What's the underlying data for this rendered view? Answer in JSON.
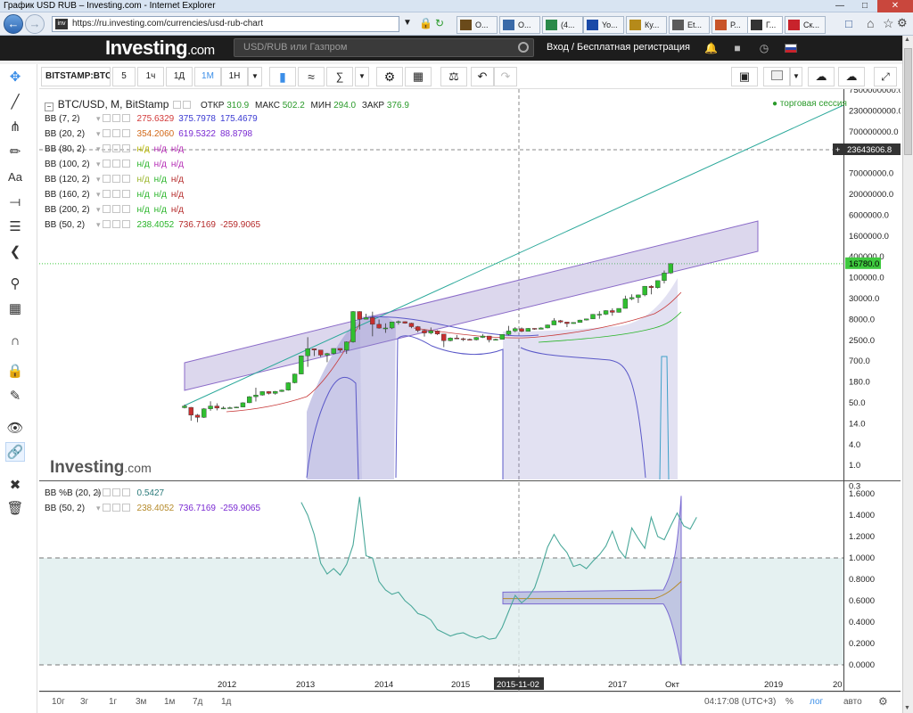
{
  "window": {
    "title": "График USD RUB – Investing.com - Internet Explorer"
  },
  "browser": {
    "url": "https://ru.investing.com/currencies/usd-rub-chart",
    "tabs": [
      {
        "label": "О...",
        "icon": "chart-favicon-icon"
      },
      {
        "label": "О...",
        "icon": "chart-favicon-icon"
      },
      {
        "label": "(4...",
        "icon": "dollar-favicon-icon"
      },
      {
        "label": "Yo...",
        "icon": "yo-favicon-icon"
      },
      {
        "label": "Ку...",
        "icon": "coin-favicon-icon"
      },
      {
        "label": "Et...",
        "icon": "eth-favicon-icon"
      },
      {
        "label": "Р...",
        "icon": "arrows-favicon-icon"
      },
      {
        "label": "Г...",
        "icon": "investing-favicon-icon"
      },
      {
        "label": "Ск...",
        "icon": "mail-favicon-icon"
      }
    ],
    "active_tab": 7
  },
  "site": {
    "logo_main": "Investing",
    "logo_suffix": ".com",
    "search_placeholder": "USD/RUB или Газпром",
    "login": "Вход / Бесплатная регистрация"
  },
  "toolbar": {
    "symbol": "BITSTAMP:BTC/",
    "intervals": [
      "5",
      "1ч",
      "1Д",
      "1М",
      "1Н"
    ],
    "selected_interval": "1М"
  },
  "legend": {
    "title": "BTC/USD, M, BitStamp",
    "open_label": "ОТКР",
    "open": "310.9",
    "high_label": "МАКС",
    "high": "502.2",
    "low_label": "МИН",
    "low": "294.0",
    "close_label": "ЗАКР",
    "close": "376.9",
    "session": "торговая сессия",
    "studies": [
      {
        "name": "BB (7, 2)",
        "v1": "275.6329",
        "v2": "375.7978",
        "v3": "175.4679",
        "c1": "#d23a3a",
        "c2": "#3a3ad2",
        "c3": "#3a3ad2"
      },
      {
        "name": "BB (20, 2)",
        "v1": "354.2060",
        "v2": "619.5322",
        "v3": "88.8798",
        "c1": "#d26a1a",
        "c2": "#7a2ad2",
        "c3": "#7a2ad2"
      },
      {
        "name": "BB (80, 2)",
        "v1": "н/д",
        "v2": "н/д",
        "v3": "н/д",
        "c1": "#b5b500",
        "c2": "#b52ab5",
        "c3": "#b52ab5"
      },
      {
        "name": "BB (100, 2)",
        "v1": "н/д",
        "v2": "н/д",
        "v3": "н/д",
        "c1": "#2ab52a",
        "c2": "#b52ab5",
        "c3": "#b52ab5"
      },
      {
        "name": "BB (120, 2)",
        "v1": "н/д",
        "v2": "н/д",
        "v3": "н/д",
        "c1": "#9ab52a",
        "c2": "#2ab52a",
        "c3": "#b52a2a"
      },
      {
        "name": "BB (160, 2)",
        "v1": "н/д",
        "v2": "н/д",
        "v3": "н/д",
        "c1": "#2ab52a",
        "c2": "#2ab52a",
        "c3": "#b52a2a"
      },
      {
        "name": "BB (200, 2)",
        "v1": "н/д",
        "v2": "н/д",
        "v3": "н/д",
        "c1": "#2ab52a",
        "c2": "#2ab52a",
        "c3": "#b52a2a"
      },
      {
        "name": "BB (50, 2)",
        "v1": "238.4052",
        "v2": "736.7169",
        "v3": "-259.9065",
        "c1": "#2ab52a",
        "c2": "#b52a2a",
        "c3": "#b52a2a"
      }
    ],
    "sub_studies": [
      {
        "name": "BB %B (20, 2)",
        "v1": "0.5427",
        "c1": "#2a7a7a"
      },
      {
        "name": "BB (50, 2)",
        "v1": "238.4052",
        "v2": "736.7169",
        "v3": "-259.9065",
        "c1": "#b58a2a",
        "c2": "#7a2ad2",
        "c3": "#7a2ad2"
      }
    ]
  },
  "watermark": {
    "main": "Investing",
    "suffix": ".com"
  },
  "price_axis": {
    "labels": [
      "7500000000.0",
      "2300000000.0",
      "700000000.0",
      "200000000.0",
      "70000000.0",
      "20000000.0",
      "6000000.0",
      "1600000.0",
      "400000.0",
      "100000.0",
      "30000.0",
      "8000.0",
      "2500.0",
      "700.0",
      "180.0",
      "50.0",
      "14.0",
      "4.0",
      "1.0",
      "0.3"
    ],
    "crosshair_value": "23643606.8",
    "last_value": "16780.0"
  },
  "osc_axis": {
    "labels": [
      "1.6000",
      "1.4000",
      "1.2000",
      "1.0000",
      "0.8000",
      "0.6000",
      "0.4000",
      "0.2000",
      "0.0000"
    ]
  },
  "time_axis": {
    "labels": [
      "2012",
      "2013",
      "2014",
      "2015",
      "2017",
      "Окт",
      "2019",
      "20"
    ],
    "crosshair_date": "2015-11-02"
  },
  "bottom": {
    "ranges": [
      "10г",
      "3г",
      "1г",
      "3м",
      "1м",
      "7д",
      "1д"
    ],
    "clock": "04:17:08 (UTC+3)",
    "percent": "%",
    "log": "лог",
    "auto": "авто"
  },
  "chart_data": {
    "type": "candlestick",
    "title": "BTC/USD, M, BitStamp",
    "scale": "log",
    "x_range": [
      "2011-09",
      "2017-12"
    ],
    "last_close": 16780,
    "candles": [
      {
        "t": "2011-09",
        "o": 5,
        "c": 5.5,
        "h": 6,
        "l": 4.8
      },
      {
        "t": "2011-10",
        "o": 5.1,
        "c": 3.3,
        "h": 5.2,
        "l": 2.4
      },
      {
        "t": "2011-11",
        "o": 3.3,
        "c": 2.9,
        "h": 3.5,
        "l": 2.2
      },
      {
        "t": "2011-12",
        "o": 2.9,
        "c": 4.7,
        "h": 4.9,
        "l": 2.8
      },
      {
        "t": "2012-01",
        "o": 4.7,
        "c": 5.5,
        "h": 7.2,
        "l": 4.2
      },
      {
        "t": "2012-02",
        "o": 5.5,
        "c": 4.9,
        "h": 6.4,
        "l": 4.3
      },
      {
        "t": "2012-03",
        "o": 4.9,
        "c": 4.9,
        "h": 5.4,
        "l": 4.6
      },
      {
        "t": "2012-04",
        "o": 4.9,
        "c": 5.0,
        "h": 5.3,
        "l": 4.8
      },
      {
        "t": "2012-05",
        "o": 5.0,
        "c": 5.2,
        "h": 5.3,
        "l": 4.9
      },
      {
        "t": "2012-06",
        "o": 5.2,
        "c": 6.6,
        "h": 6.8,
        "l": 5.1
      },
      {
        "t": "2012-07",
        "o": 6.6,
        "c": 9.3,
        "h": 9.6,
        "l": 6.5
      },
      {
        "t": "2012-08",
        "o": 9.3,
        "c": 10.2,
        "h": 15.4,
        "l": 7.1
      },
      {
        "t": "2012-09",
        "o": 10.2,
        "c": 12.4,
        "h": 12.6,
        "l": 9.9
      },
      {
        "t": "2012-10",
        "o": 12.4,
        "c": 11.2,
        "h": 12.7,
        "l": 10.5
      },
      {
        "t": "2012-11",
        "o": 11.2,
        "c": 12.5,
        "h": 12.9,
        "l": 10.4
      },
      {
        "t": "2012-12",
        "o": 12.5,
        "c": 13.5,
        "h": 13.9,
        "l": 12.2
      },
      {
        "t": "2013-01",
        "o": 13.5,
        "c": 20.4,
        "h": 21,
        "l": 13.1
      },
      {
        "t": "2013-02",
        "o": 20.4,
        "c": 33.4,
        "h": 34,
        "l": 19.7
      },
      {
        "t": "2013-03",
        "o": 33.4,
        "c": 93,
        "h": 95,
        "l": 33
      },
      {
        "t": "2013-04",
        "o": 93,
        "c": 139,
        "h": 266,
        "l": 50
      },
      {
        "t": "2013-05",
        "o": 139,
        "c": 129,
        "h": 140,
        "l": 92
      },
      {
        "t": "2013-06",
        "o": 129,
        "c": 97,
        "h": 130,
        "l": 88
      },
      {
        "t": "2013-07",
        "o": 97,
        "c": 106,
        "h": 110,
        "l": 65
      },
      {
        "t": "2013-08",
        "o": 106,
        "c": 141,
        "h": 141,
        "l": 101
      },
      {
        "t": "2013-09",
        "o": 141,
        "c": 128,
        "h": 142,
        "l": 116
      },
      {
        "t": "2013-10",
        "o": 128,
        "c": 204,
        "h": 210,
        "l": 104
      },
      {
        "t": "2013-11",
        "o": 204,
        "c": 1129,
        "h": 1163,
        "l": 195
      },
      {
        "t": "2013-12",
        "o": 1129,
        "c": 732,
        "h": 1150,
        "l": 410
      },
      {
        "t": "2014-01",
        "o": 732,
        "c": 800,
        "h": 1000,
        "l": 730
      },
      {
        "t": "2014-02",
        "o": 800,
        "c": 550,
        "h": 1120,
        "l": 280
      },
      {
        "t": "2014-03",
        "o": 550,
        "c": 445,
        "h": 720,
        "l": 430
      },
      {
        "t": "2014-04",
        "o": 445,
        "c": 447,
        "h": 580,
        "l": 340
      },
      {
        "t": "2014-05",
        "o": 447,
        "c": 628,
        "h": 630,
        "l": 420
      },
      {
        "t": "2014-06",
        "o": 628,
        "c": 638,
        "h": 680,
        "l": 540
      },
      {
        "t": "2014-07",
        "o": 638,
        "c": 586,
        "h": 650,
        "l": 570
      },
      {
        "t": "2014-08",
        "o": 586,
        "c": 481,
        "h": 600,
        "l": 442
      },
      {
        "t": "2014-09",
        "o": 481,
        "c": 388,
        "h": 500,
        "l": 349
      },
      {
        "t": "2014-10",
        "o": 388,
        "c": 337,
        "h": 412,
        "l": 275
      },
      {
        "t": "2014-11",
        "o": 337,
        "c": 378,
        "h": 460,
        "l": 312
      },
      {
        "t": "2014-12",
        "o": 378,
        "c": 318,
        "h": 395,
        "l": 301
      },
      {
        "t": "2015-01",
        "o": 318,
        "c": 218,
        "h": 320,
        "l": 152
      },
      {
        "t": "2015-02",
        "o": 218,
        "c": 254,
        "h": 264,
        "l": 210
      },
      {
        "t": "2015-03",
        "o": 254,
        "c": 244,
        "h": 300,
        "l": 240
      },
      {
        "t": "2015-04",
        "o": 244,
        "c": 236,
        "h": 260,
        "l": 214
      },
      {
        "t": "2015-05",
        "o": 236,
        "c": 230,
        "h": 247,
        "l": 228
      },
      {
        "t": "2015-06",
        "o": 230,
        "c": 263,
        "h": 268,
        "l": 221
      },
      {
        "t": "2015-07",
        "o": 263,
        "c": 284,
        "h": 317,
        "l": 254
      },
      {
        "t": "2015-08",
        "o": 284,
        "c": 230,
        "h": 286,
        "l": 198
      },
      {
        "t": "2015-09",
        "o": 230,
        "c": 236,
        "h": 245,
        "l": 225
      },
      {
        "t": "2015-10",
        "o": 236,
        "c": 311,
        "h": 316,
        "l": 235
      },
      {
        "t": "2015-11",
        "o": 311,
        "c": 377,
        "h": 502,
        "l": 294
      },
      {
        "t": "2015-12",
        "o": 377,
        "c": 431,
        "h": 468,
        "l": 354
      },
      {
        "t": "2016-01",
        "o": 431,
        "c": 369,
        "h": 462,
        "l": 354
      },
      {
        "t": "2016-02",
        "o": 369,
        "c": 437,
        "h": 445,
        "l": 366
      },
      {
        "t": "2016-03",
        "o": 437,
        "c": 416,
        "h": 439,
        "l": 404
      },
      {
        "t": "2016-04",
        "o": 416,
        "c": 448,
        "h": 466,
        "l": 413
      },
      {
        "t": "2016-05",
        "o": 448,
        "c": 531,
        "h": 542,
        "l": 437
      },
      {
        "t": "2016-06",
        "o": 531,
        "c": 673,
        "h": 780,
        "l": 528
      },
      {
        "t": "2016-07",
        "o": 673,
        "c": 624,
        "h": 704,
        "l": 590
      },
      {
        "t": "2016-08",
        "o": 624,
        "c": 573,
        "h": 628,
        "l": 470
      },
      {
        "t": "2016-09",
        "o": 573,
        "c": 609,
        "h": 611,
        "l": 569
      },
      {
        "t": "2016-10",
        "o": 609,
        "c": 698,
        "h": 712,
        "l": 603
      },
      {
        "t": "2016-11",
        "o": 698,
        "c": 745,
        "h": 755,
        "l": 682
      },
      {
        "t": "2016-12",
        "o": 745,
        "c": 966,
        "h": 980,
        "l": 742
      },
      {
        "t": "2017-01",
        "o": 966,
        "c": 970,
        "h": 1153,
        "l": 751
      },
      {
        "t": "2017-02",
        "o": 970,
        "c": 1190,
        "h": 1210,
        "l": 930
      },
      {
        "t": "2017-03",
        "o": 1190,
        "c": 1080,
        "h": 1350,
        "l": 891
      },
      {
        "t": "2017-04",
        "o": 1080,
        "c": 1348,
        "h": 1350,
        "l": 1060
      },
      {
        "t": "2017-05",
        "o": 1348,
        "c": 2300,
        "h": 2760,
        "l": 1340
      },
      {
        "t": "2017-06",
        "o": 2300,
        "c": 2480,
        "h": 2980,
        "l": 2140
      },
      {
        "t": "2017-07",
        "o": 2480,
        "c": 2880,
        "h": 2930,
        "l": 1830
      },
      {
        "t": "2017-08",
        "o": 2880,
        "c": 4700,
        "h": 4750,
        "l": 2670
      },
      {
        "t": "2017-09",
        "o": 4700,
        "c": 4340,
        "h": 4980,
        "l": 2980
      },
      {
        "t": "2017-10",
        "o": 4340,
        "c": 6450,
        "h": 6470,
        "l": 4120
      },
      {
        "t": "2017-11",
        "o": 6450,
        "c": 9900,
        "h": 11400,
        "l": 5500
      },
      {
        "t": "2017-12",
        "o": 9900,
        "c": 16780,
        "h": 17200,
        "l": 9400
      }
    ],
    "oscillator": {
      "name": "BB %B (20, 2)",
      "x_start": "2013-03",
      "values": [
        1.52,
        1.4,
        1.22,
        0.95,
        0.85,
        0.9,
        0.84,
        0.94,
        1.12,
        1.57,
        1.02,
        1.0,
        0.78,
        0.7,
        0.66,
        0.68,
        0.6,
        0.55,
        0.48,
        0.46,
        0.42,
        0.33,
        0.3,
        0.27,
        0.29,
        0.3,
        0.27,
        0.25,
        0.27,
        0.24,
        0.25,
        0.35,
        0.5,
        0.65,
        0.58,
        0.63,
        0.72,
        0.9,
        1.1,
        1.22,
        1.12,
        1.05,
        0.92,
        0.94,
        0.9,
        0.97,
        1.03,
        1.11,
        1.25,
        1.08,
        1.0,
        1.28,
        1.18,
        1.09,
        1.38,
        1.2,
        1.17,
        1.3,
        1.42,
        1.3,
        1.27,
        1.38
      ],
      "ylim": [
        0,
        1.6
      ],
      "levels": [
        1.0,
        0.0
      ]
    }
  }
}
